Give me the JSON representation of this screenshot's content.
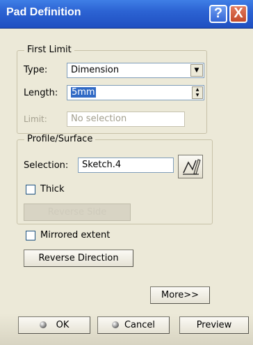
{
  "window": {
    "title": "Pad Definition",
    "help_glyph": "?",
    "close_glyph": "X"
  },
  "first_limit": {
    "legend": "First Limit",
    "type_label": "Type:",
    "type_value": "Dimension",
    "length_label": "Length:",
    "length_value": "5mm",
    "limit_label": "Limit:",
    "limit_value": "No selection"
  },
  "profile_surface": {
    "legend": "Profile/Surface",
    "selection_label": "Selection:",
    "selection_value": "Sketch.4",
    "thick_label": "Thick",
    "reverse_side_label": "Reverse Side"
  },
  "mirrored_extent_label": "Mirrored extent",
  "reverse_direction_label": "Reverse Direction",
  "more_label": "More>>",
  "footer": {
    "ok_label": "OK",
    "cancel_label": "Cancel",
    "preview_label": "Preview"
  }
}
